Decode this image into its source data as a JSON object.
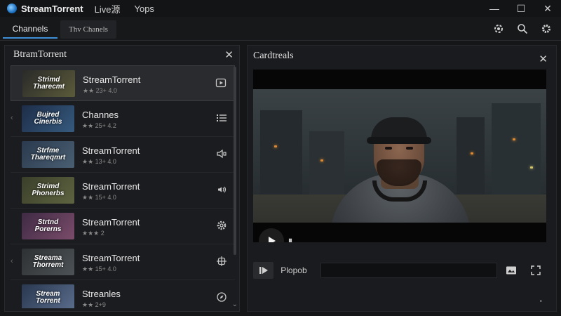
{
  "app": {
    "title": "StreamTorrent",
    "menu": [
      "Live源",
      "Yops"
    ]
  },
  "window_controls": {
    "minimize": "—",
    "maximize": "☐",
    "close": "✕"
  },
  "tabs": [
    {
      "label": "Channels",
      "active": true
    },
    {
      "label": "Thv Chanels",
      "active": false
    }
  ],
  "toolbar": {
    "icons": [
      "spinner-gear-icon",
      "search-icon",
      "settings-gear-icon"
    ]
  },
  "left_panel": {
    "title": "BtramTorrent",
    "close": "✕",
    "items": [
      {
        "thumb_text": "Strimd Tharecmt",
        "thumb_colors": [
          "#2a2a2a",
          "#5b5b3a"
        ],
        "title": "StreamTorrent",
        "rating": "★★ 23+ 4.0",
        "icon": "play-box-icon",
        "selected": true
      },
      {
        "thumb_text": "Bujred Cinerbis",
        "thumb_colors": [
          "#1d2d48",
          "#365a7e"
        ],
        "title": "Channes",
        "rating": "★★ 25+ 4.2",
        "icon": "list-icon",
        "selected": false
      },
      {
        "thumb_text": "Strfme Thareqmrt",
        "thumb_colors": [
          "#2b3a4e",
          "#4a5f72"
        ],
        "title": "StreamTorrent",
        "rating": "★★ 13+ 4.0",
        "icon": "speaker-icon",
        "selected": false
      },
      {
        "thumb_text": "Strimd Phonerbs",
        "thumb_colors": [
          "#3a3f2a",
          "#5e6440"
        ],
        "title": "StreamTorrent",
        "rating": "★★ 15+ 4.0",
        "icon": "volume-icon",
        "selected": false
      },
      {
        "thumb_text": "Strtnd Porerns",
        "thumb_colors": [
          "#3f2a44",
          "#7a4c6a"
        ],
        "title": "StreamTorrent",
        "rating": "★★★ 2",
        "icon": "gear-icon",
        "selected": false
      },
      {
        "thumb_text": "Streama Thorremt",
        "thumb_colors": [
          "#2e3133",
          "#4c5256"
        ],
        "title": "StreamTorrent",
        "rating": "★★ 15+ 4.0",
        "icon": "target-icon",
        "selected": false
      },
      {
        "thumb_text": "Stream Torrent",
        "thumb_colors": [
          "#2a3850",
          "#5a6d8c"
        ],
        "title": "Streanles",
        "rating": "★★ 2+9",
        "icon": "compass-icon",
        "selected": false
      }
    ]
  },
  "right_panel": {
    "title": "Cardtreals",
    "close": "✕",
    "controls": {
      "label": "Plopob"
    }
  }
}
